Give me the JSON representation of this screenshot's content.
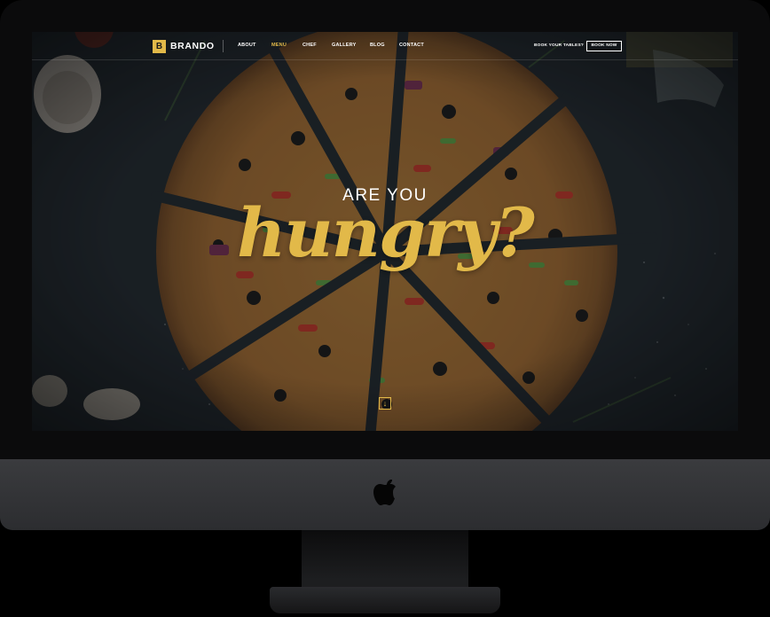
{
  "brand": {
    "logo_letter": "B",
    "name": "BRANDO",
    "accent": "#e2b949"
  },
  "nav": {
    "links": [
      "ABOUT",
      "MENU",
      "CHEF",
      "GALLERY",
      "BLOG",
      "CONTACT"
    ],
    "active": "MENU",
    "book_tables": "BOOK YOUR TABLES?",
    "book_now": "BOOK NOW"
  },
  "hero": {
    "line1": "ARE YOU",
    "line2": "hungry?",
    "scroll_icon": "arrow-down-icon"
  },
  "device": {
    "type": "imac",
    "logo": "apple-logo-icon"
  }
}
